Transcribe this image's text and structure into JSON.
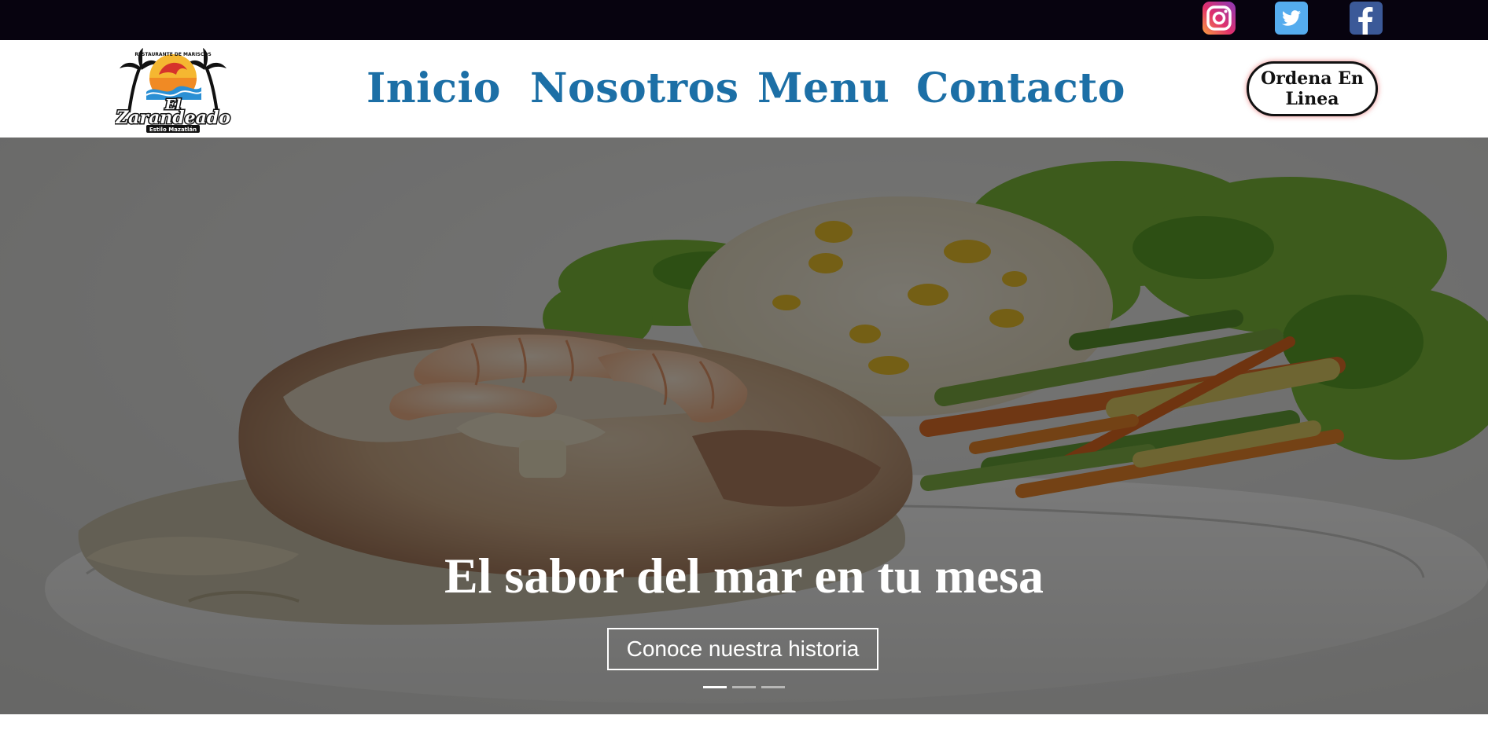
{
  "topbar": {
    "social": [
      {
        "name": "instagram",
        "icon": "instagram-icon",
        "color": "#e1306c"
      },
      {
        "name": "twitter",
        "icon": "twitter-icon",
        "color": "#55acee"
      },
      {
        "name": "facebook",
        "icon": "facebook-icon",
        "color": "#3b5998"
      }
    ]
  },
  "brand": {
    "logo_line1": "El",
    "logo_line2": "Zarandeado",
    "logo_tagline": "Estilo Mazatlán",
    "logo_arc": "RESTAURANTE DE MARISCOS"
  },
  "nav": {
    "items": [
      {
        "label": "Inicio"
      },
      {
        "label": "Nosotros"
      },
      {
        "label": "Menu"
      },
      {
        "label": "Contacto"
      }
    ],
    "order_label": "Ordena En Linea",
    "link_color": "#1c6fa6"
  },
  "hero": {
    "title": "El sabor del mar en tu mesa",
    "button_label": "Conoce nuestra historia",
    "slide_count": 3,
    "active_slide": 1
  }
}
